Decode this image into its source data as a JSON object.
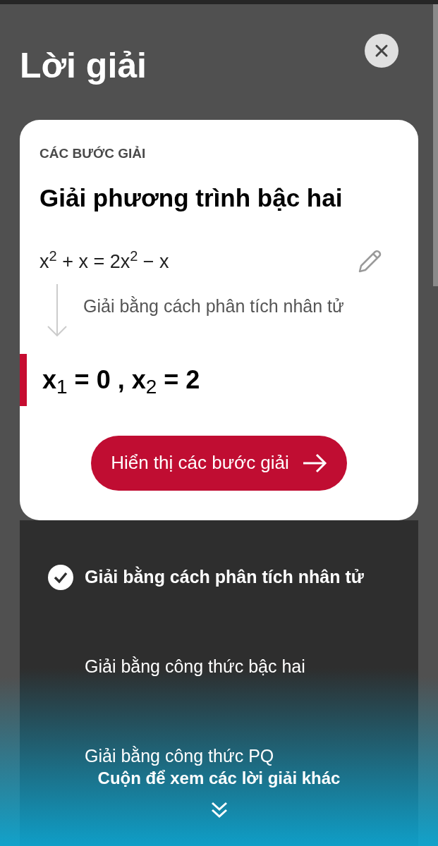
{
  "title": "Lời giải",
  "card": {
    "section_label": "CÁC BƯỚC GIẢI",
    "heading": "Giải phương trình bậc hai",
    "equation": "x$^{2}$ + x = 2x$^{2}$ − x",
    "method_hint": "Giải bằng cách phân tích nhân tử",
    "result": "x$_{1}$ = 0 , x$_{2}$ = 2",
    "button": "Hiển thị các bước giải"
  },
  "methods": [
    {
      "label": "Giải bằng cách phân tích nhân tử",
      "selected": true
    },
    {
      "label": "Giải bằng công thức bậc hai",
      "selected": false
    },
    {
      "label": "Giải bằng công thức PQ",
      "selected": false
    }
  ],
  "scroll_hint": "Cuộn để xem các lời giải khác"
}
